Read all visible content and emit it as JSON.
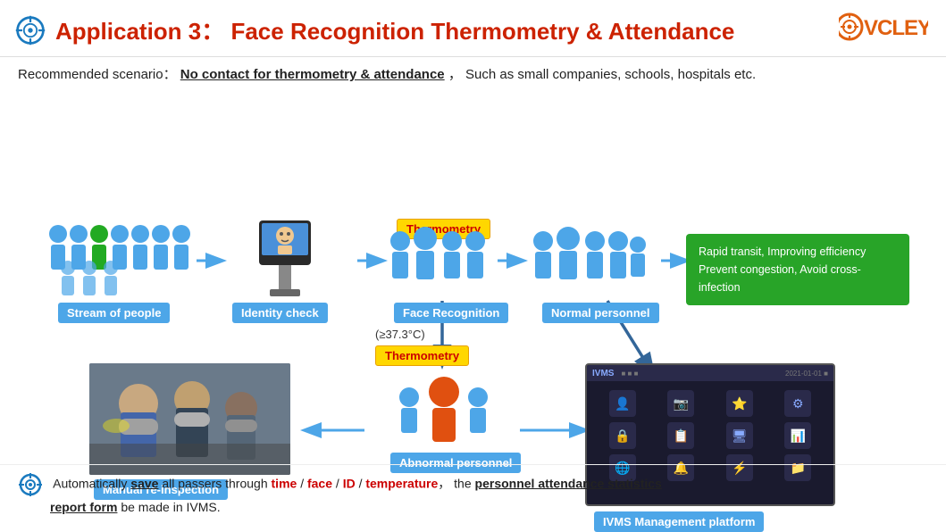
{
  "header": {
    "icon_label": "application-icon",
    "title_prefix": "Application 3：  Face Recognition Thermometry & ",
    "title_highlight": "Attendance",
    "logo_text": "VCLEY"
  },
  "scenario": {
    "label": "Recommended scenario：",
    "highlight": "No contact for thermometry & attendance",
    "rest": "，  Such as small companies, schools, hospitals etc."
  },
  "labels": {
    "stream": "Stream of people",
    "identity": "Identity check",
    "face_recog": "Face Recognition",
    "normal": "Normal personnel",
    "thermometry1": "Thermometry",
    "thermometry2": "Thermometry",
    "temp_note": "(≥37.3°C)",
    "abnormal": "Abnormal personnel",
    "manual": "Manual re-inspection",
    "ivms_title": "IVMS",
    "ivms_platform": "IVMS Management platform",
    "green_line1": "Rapid transit, Improving efficiency",
    "green_line2": "Prevent congestion, Avoid cross-infection"
  },
  "bottom": {
    "prefix": "Automatically ",
    "save": "save",
    "after_save": " all passers through ",
    "time": "time",
    "slash1": " / ",
    "face": "face",
    "slash2": " / ",
    "id": "ID",
    "slash3": " / ",
    "temperature": "temperature",
    "comma": "，  the ",
    "stats": "personnel attendance statistics",
    "report": "report form",
    "end": " be made in IVMS."
  },
  "ivms_icons": [
    {
      "icon": "👤",
      "label": ""
    },
    {
      "icon": "📷",
      "label": ""
    },
    {
      "icon": "⭐",
      "label": ""
    },
    {
      "icon": "⚙",
      "label": ""
    },
    {
      "icon": "🔒",
      "label": ""
    },
    {
      "icon": "📋",
      "label": ""
    },
    {
      "icon": "🖥",
      "label": ""
    },
    {
      "icon": "📊",
      "label": ""
    },
    {
      "icon": "🌐",
      "label": ""
    },
    {
      "icon": "🔔",
      "label": ""
    },
    {
      "icon": "📁",
      "label": ""
    },
    {
      "icon": "⚡",
      "label": ""
    }
  ]
}
